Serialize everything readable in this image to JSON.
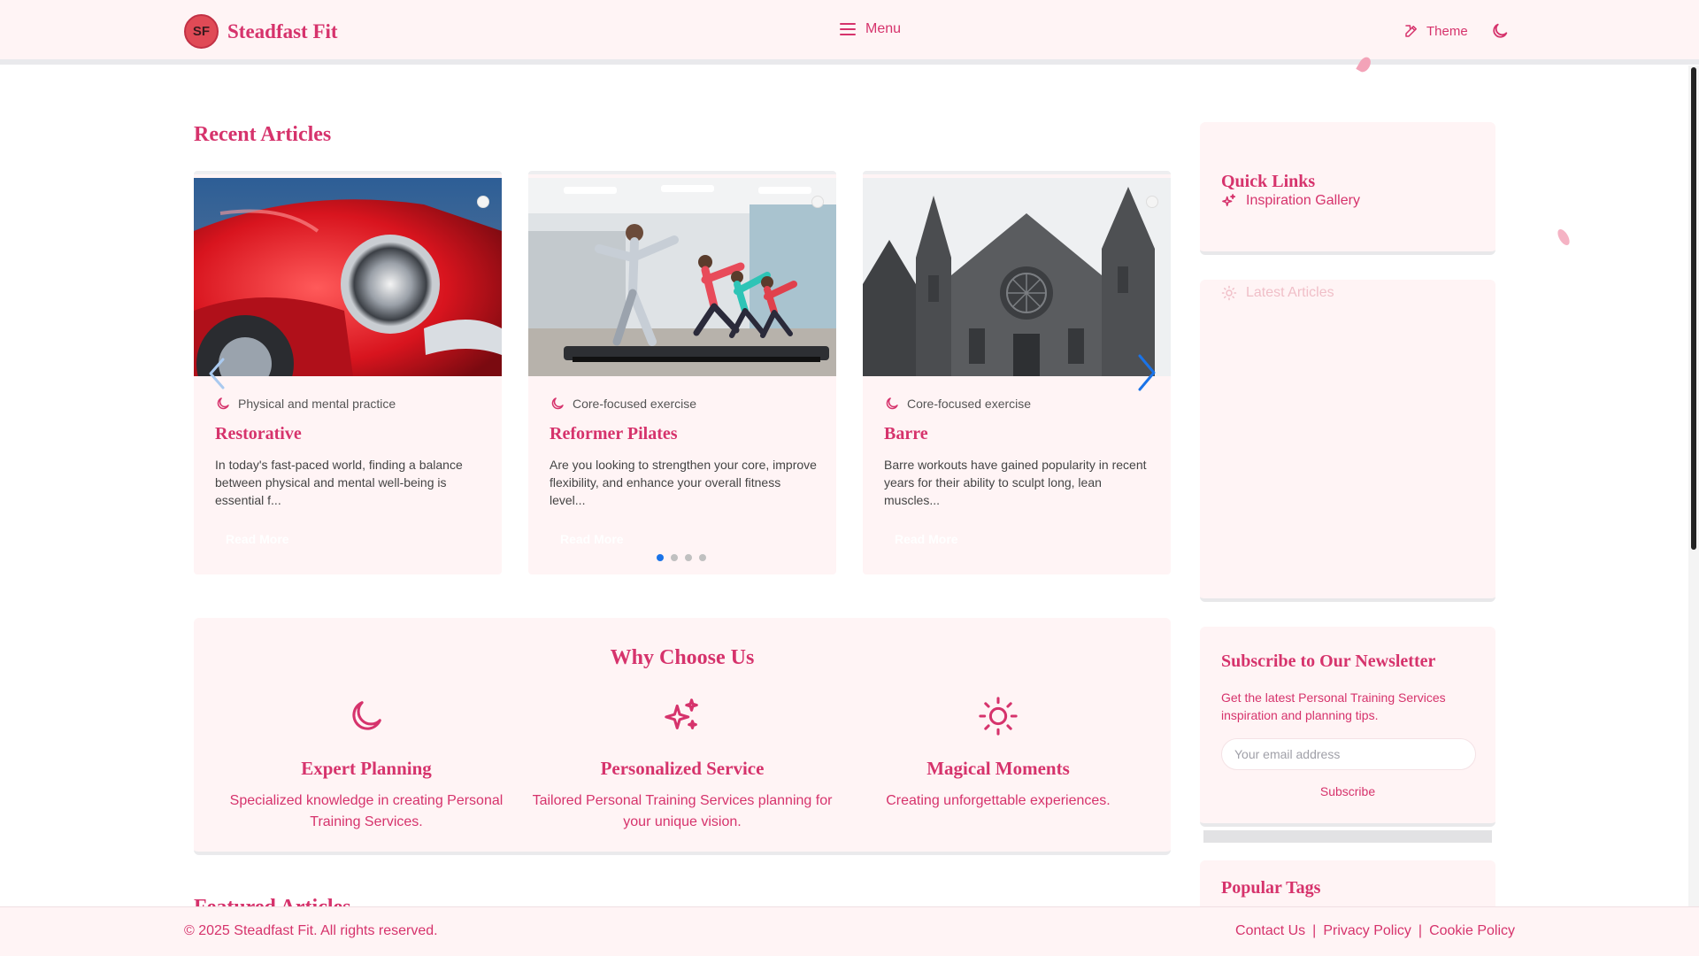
{
  "header": {
    "logo_text": "SF",
    "brand": "Steadfast Fit",
    "menu_label": "Menu",
    "theme_label": "Theme"
  },
  "recent": {
    "title": "Recent Articles",
    "cards": [
      {
        "category": "Physical and mental practice",
        "title": "Restorative",
        "desc": "In today's fast-paced world, finding a balance between physical and mental well-being is essential f...",
        "read": "Read More",
        "icon": "moon-icon",
        "image": "red-car-photo"
      },
      {
        "category": "Core-focused exercise",
        "title": "Reformer Pilates",
        "desc": "Are you looking to strengthen your core, improve flexibility, and enhance your overall fitness level...",
        "read": "Read More",
        "icon": "moon-icon",
        "image": "pilates-class-photo"
      },
      {
        "category": "Core-focused exercise",
        "title": "Barre",
        "desc": "Barre workouts have gained popularity in recent years for their ability to sculpt long, lean muscles...",
        "read": "Read More",
        "icon": "moon-icon",
        "image": "cathedral-photo"
      }
    ],
    "carousel_pages": 4,
    "carousel_active": 1
  },
  "why": {
    "title": "Why Choose Us",
    "features": [
      {
        "icon": "moon-icon",
        "title": "Expert Planning",
        "desc": "Specialized knowledge in creating Personal Training Services."
      },
      {
        "icon": "sparkles-icon",
        "title": "Personalized Service",
        "desc": "Tailored Personal Training Services planning for your unique vision."
      },
      {
        "icon": "sun-icon",
        "title": "Magical Moments",
        "desc": "Creating unforgettable experiences."
      }
    ]
  },
  "featured_peek": "Featured Articles",
  "sidebar": {
    "quick_title": "Quick Links",
    "quick_link": "Inspiration Gallery",
    "latest_title": "Latest Articles",
    "newsletter_title": "Subscribe to Our Newsletter",
    "newsletter_desc": "Get the latest Personal Training Services inspiration and planning tips.",
    "email_placeholder": "Your email address",
    "subscribe_label": "Subscribe",
    "tags_title": "Popular Tags"
  },
  "footer": {
    "copyright": "© 2025 Steadfast Fit. All rights reserved.",
    "links": [
      "Contact Us",
      "Privacy Policy",
      "Cookie Policy"
    ],
    "separator": "|"
  },
  "colors": {
    "accent": "#d6336c",
    "surface": "#fff4f5",
    "carousel_active": "#1a73e8"
  }
}
